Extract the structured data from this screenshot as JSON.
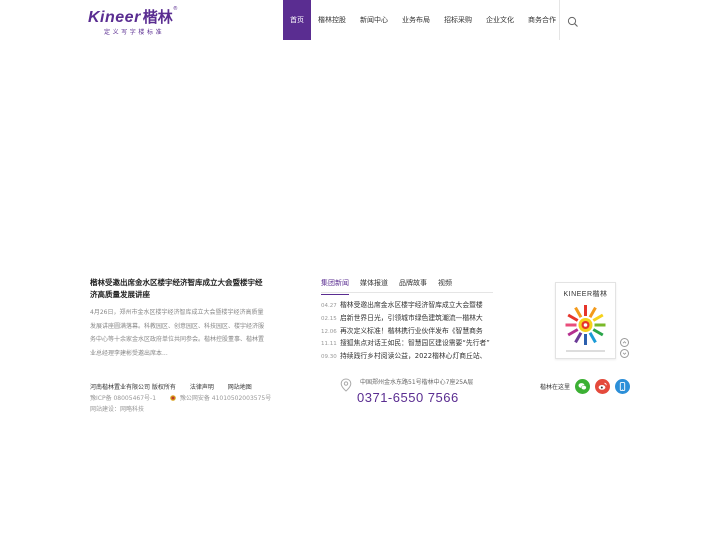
{
  "brand": {
    "name_en": "Kineer",
    "name_cn": "楷林",
    "reg": "®",
    "slogan": "定义写字楼标准"
  },
  "nav": {
    "items": [
      "首页",
      "楷林控股",
      "新闻中心",
      "业务布局",
      "招标采购",
      "企业文化",
      "商务合作"
    ],
    "active_index": 0
  },
  "feature": {
    "title": "楷林受邀出席金水区楼宇经济智库成立大会暨楼宇经济高质量发展讲座",
    "desc": "4月26日，郑州市金水区楼宇经济智库成立大会暨楼宇经济高质量发展讲座圆满落幕。科教园区、创意园区、科技园区、楼宇经济服务中心等十余家金水区政府单位共同参会。楷林控股董事、楷林置业总经理李建彬受邀出席本..."
  },
  "news": {
    "tabs": [
      "集团新闻",
      "媒体报道",
      "品牌故事",
      "视频"
    ],
    "active_tab": 0,
    "items": [
      {
        "date": "04.27",
        "text": "楷林受邀出席金水区楼宇经济智库成立大会暨楼"
      },
      {
        "date": "02.15",
        "text": "启新世界日光，引领城市绿色建筑潮流—楷林大"
      },
      {
        "date": "12.06",
        "text": "再次定义标准！楷林携行业伙伴发布《智慧商务"
      },
      {
        "date": "11.11",
        "text": "搜狐焦点对话王如民：智慧园区建设需要“先行者”"
      },
      {
        "date": "09.30",
        "text": "持续践行乡村阅读公益，2022楷林心灯商丘站、"
      }
    ]
  },
  "magazine": {
    "title": "KINEER楷林"
  },
  "footer": {
    "company": "河南楷林置业有限公司 版权所有",
    "legal": "法律声明",
    "sitemap": "网站地图",
    "icp": "豫ICP备 08005467号-1",
    "police": "豫公网安备 41010502003575号",
    "support": "网站建设：网略科技",
    "address": "中国郑州金水东路51号楷林中心7座25A层",
    "phone": "0371-6550 7566",
    "social_label": "楷林在这里",
    "colors": {
      "accent": "#5a2d91",
      "wechat": "#3cb034",
      "weibo": "#e44a3c",
      "mobile": "#2c8fd8"
    }
  }
}
